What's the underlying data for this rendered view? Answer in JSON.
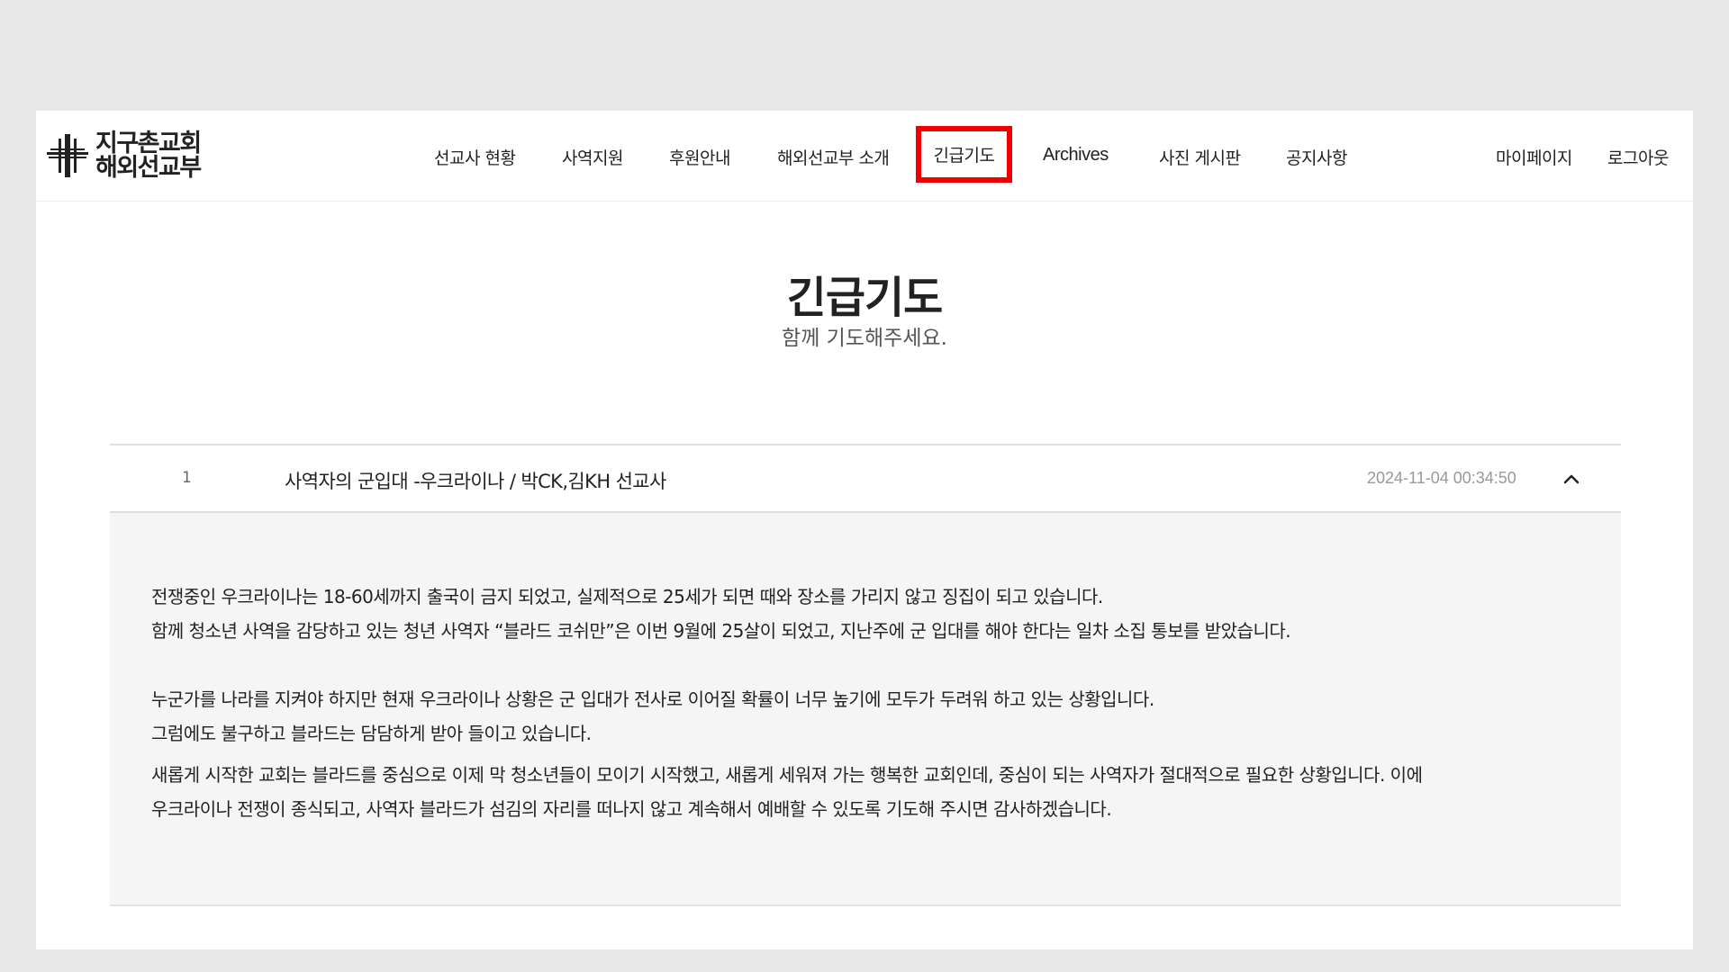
{
  "brand": {
    "logo_line1": "지구촌교회",
    "logo_line2": "해외선교부"
  },
  "nav": {
    "items": [
      {
        "label": "선교사 현황"
      },
      {
        "label": "사역지원"
      },
      {
        "label": "후원안내"
      },
      {
        "label": "해외선교부 소개"
      },
      {
        "label": "긴급기도"
      },
      {
        "label": "Archives"
      },
      {
        "label": "사진 게시판"
      },
      {
        "label": "공지사항"
      }
    ],
    "highlight_color": "#ee0000"
  },
  "user_menu": {
    "mypage": "마이페이지",
    "logout": "로그아웃"
  },
  "page": {
    "title": "긴급기도",
    "subtitle": "함께 기도해주세요."
  },
  "board": {
    "rows": [
      {
        "num": "1",
        "title": "사역자의 군입대 -우크라이나 / 박CK,김KH 선교사",
        "date": "2024-11-04 00:34:50",
        "toggle_icon": "chevron-up-icon",
        "expanded": true
      }
    ],
    "content": {
      "p1_l1": "전쟁중인 우크라이나는 18-60세까지 출국이 금지 되었고,  실제적으로 25세가 되면 때와 장소를 가리지 않고 징집이 되고 있습니다.",
      "p1_l2": "함께 청소년 사역을 감당하고 있는  청년 사역자 “블라드 코쉬만”은 이번 9월에 25살이 되었고,  지난주에 군 입대를 해야 한다는 일차 소집 통보를 받았습니다.",
      "p2_l1": " 누군가를 나라를 지켜야 하지만  현재 우크라이나 상황은 군 입대가  전사로 이어질 확률이 너무 높기에 모두가 두려워 하고 있는 상황입니다.",
      "p2_l2": "그럼에도 불구하고 블라드는 담담하게 받아 들이고 있습니다.",
      "p3_l1": "새롭게 시작한 교회는 블라드를 중심으로 이제 막 청소년들이 모이기 시작했고,  새롭게 세워져 가는 행복한 교회인데, 중심이 되는 사역자가 절대적으로 필요한 상황입니다.  이에",
      "p3_l2": " 우크라이나 전쟁이 종식되고,  사역자 블라드가  섬김의 자리를 떠나지 않고 계속해서 예배할 수 있도록 기도해 주시면 감사하겠습니다."
    }
  }
}
